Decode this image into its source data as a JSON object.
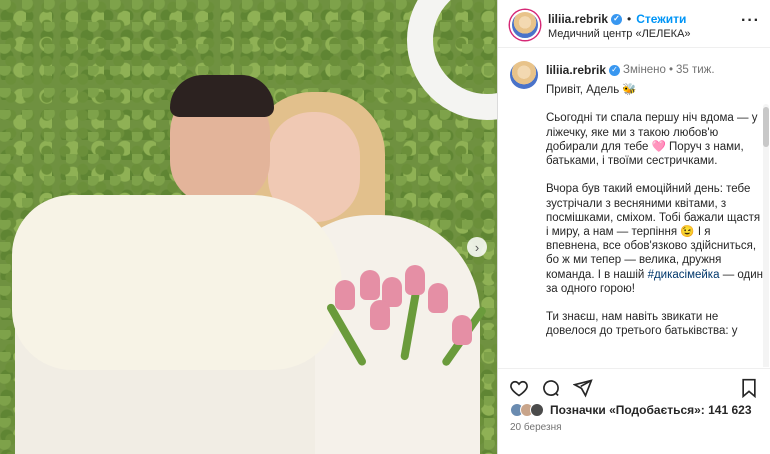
{
  "photo": {
    "next_arrow": "›"
  },
  "header": {
    "username": "liliia.rebrik",
    "verified_icon": "✓",
    "dot": "•",
    "follow_label": "Стежити",
    "location": "Медичний центр «ЛЕЛЕКА»",
    "more_label": "···"
  },
  "caption": {
    "username": "liliia.rebrik",
    "edited": "Змінено",
    "dot": "•",
    "time": "35 тиж.",
    "paragraphs": {
      "p1": "Привіт, Адель 🐝",
      "p2": "Сьогодні ти спала першу ніч вдома — у ліжечку, яке ми з такою любов'ю добирали для тебе 🩷 Поруч з нами, батьками, і твоїми сестричками.",
      "p3a": "Вчора був такий емоційний день: тебе зустрічали з весняними квітами, з посмішками, сміхом. Тобі бажали щастя і миру, а нам — терпіння 😉 І я впевнена, все обов'язково здійсниться, бо ж ми тепер — велика, дружня команда. І в нашій",
      "hashtag": "#дикасімейка",
      "p3b": "— один за одного горою!",
      "p4": "Ти знаєш, нам навіть звикати не довелося до третього батьківства: у"
    }
  },
  "footer": {
    "likes_label": "Позначки «Подобається»: 141 623",
    "date": "20 березня"
  },
  "colors": {
    "accent": "#0095f6",
    "verified": "#3897f0",
    "hashtag": "#00376b",
    "muted": "#737373"
  },
  "icons": [
    "heart-icon",
    "comment-icon",
    "share-icon",
    "bookmark-icon",
    "more-icon",
    "verified-icon",
    "chevron-right-icon"
  ]
}
